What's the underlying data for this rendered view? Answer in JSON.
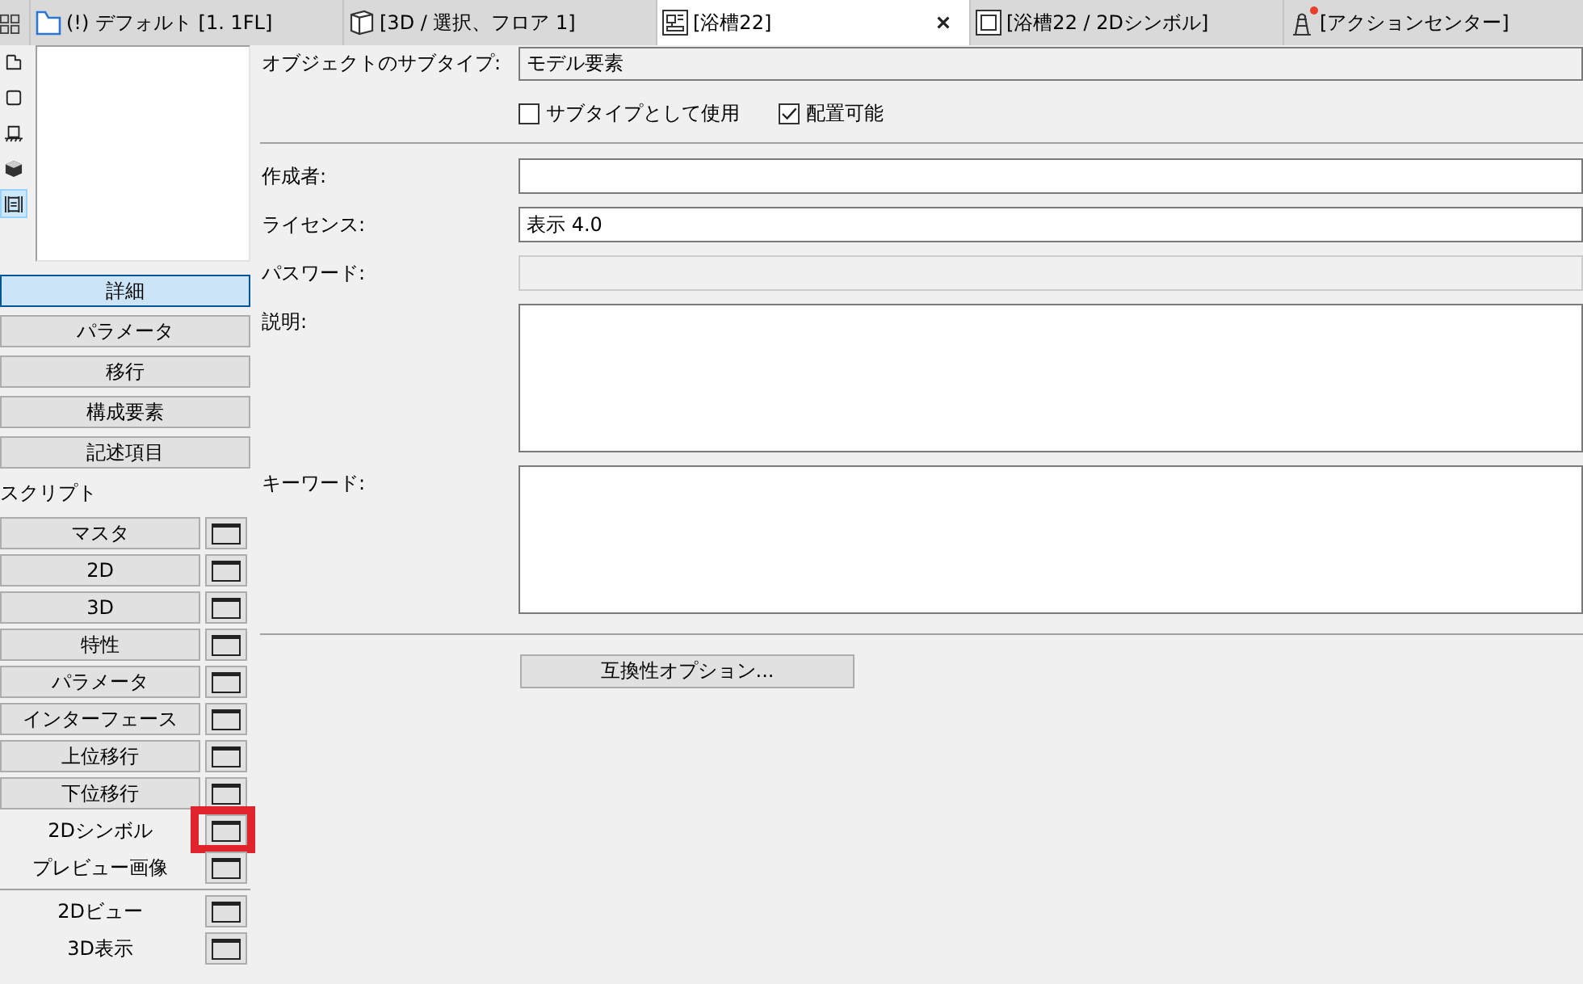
{
  "tabs": [
    {
      "label": "(!) デフォルト [1. 1FL]",
      "kind": "floorplan",
      "selected": false,
      "notification": false
    },
    {
      "label": "[3D / 選択、フロア 1]",
      "kind": "box",
      "selected": false,
      "notification": false
    },
    {
      "label": "[浴槽22]",
      "kind": "object",
      "selected": true,
      "notification": false
    },
    {
      "label": "[浴槽22 / 2Dシンボル]",
      "kind": "symbol",
      "selected": false,
      "notification": false
    },
    {
      "label": "[アクションセンター]",
      "kind": "action",
      "selected": false,
      "notification": true
    }
  ],
  "tool_icons": [
    {
      "kind": "notched",
      "selected": false
    },
    {
      "kind": "square",
      "selected": false
    },
    {
      "kind": "pedestal",
      "selected": false
    },
    {
      "kind": "cube",
      "selected": false
    },
    {
      "kind": "list",
      "selected": true
    }
  ],
  "sections": [
    {
      "label": "詳細",
      "selected": true
    },
    {
      "label": "パラメータ",
      "selected": false
    },
    {
      "label": "移行",
      "selected": false
    },
    {
      "label": "構成要素",
      "selected": false
    },
    {
      "label": "記述項目",
      "selected": false
    }
  ],
  "script_heading": "スクリプト",
  "scripts": [
    {
      "label": "マスタ",
      "kind": "button",
      "highlighted": false
    },
    {
      "label": "2D",
      "kind": "button",
      "highlighted": false
    },
    {
      "label": "3D",
      "kind": "button",
      "highlighted": false
    },
    {
      "label": "特性",
      "kind": "button",
      "highlighted": false
    },
    {
      "label": "パラメータ",
      "kind": "button",
      "highlighted": false
    },
    {
      "label": "インターフェース",
      "kind": "button",
      "highlighted": false
    },
    {
      "label": "上位移行",
      "kind": "button",
      "highlighted": false
    },
    {
      "label": "下位移行",
      "kind": "button",
      "highlighted": false
    },
    {
      "label": "2Dシンボル",
      "kind": "label",
      "highlighted": true
    },
    {
      "label": "プレビュー画像",
      "kind": "label",
      "highlighted": false
    }
  ],
  "view_scripts": [
    {
      "label": "2Dビュー",
      "kind": "label",
      "highlighted": false
    },
    {
      "label": "3D表示",
      "kind": "label",
      "highlighted": false
    }
  ],
  "subtype": {
    "label": "オブジェクトのサブタイプ:",
    "value": "モデル要素"
  },
  "checkboxes": [
    {
      "label": "サブタイプとして使用",
      "checked": false
    },
    {
      "label": "配置可能",
      "checked": true
    }
  ],
  "fields": [
    {
      "label": "作成者:",
      "kind": "text",
      "disabled": false
    },
    {
      "label": "ライセンス:",
      "kind": "text",
      "value": "表示 4.0",
      "disabled": false
    },
    {
      "label": "パスワード:",
      "kind": "text",
      "disabled": true
    },
    {
      "label": "説明:",
      "kind": "textarea",
      "disabled": false
    },
    {
      "label": "キーワード:",
      "kind": "textarea",
      "disabled": false
    }
  ],
  "compat_button": "互換性オプション..."
}
